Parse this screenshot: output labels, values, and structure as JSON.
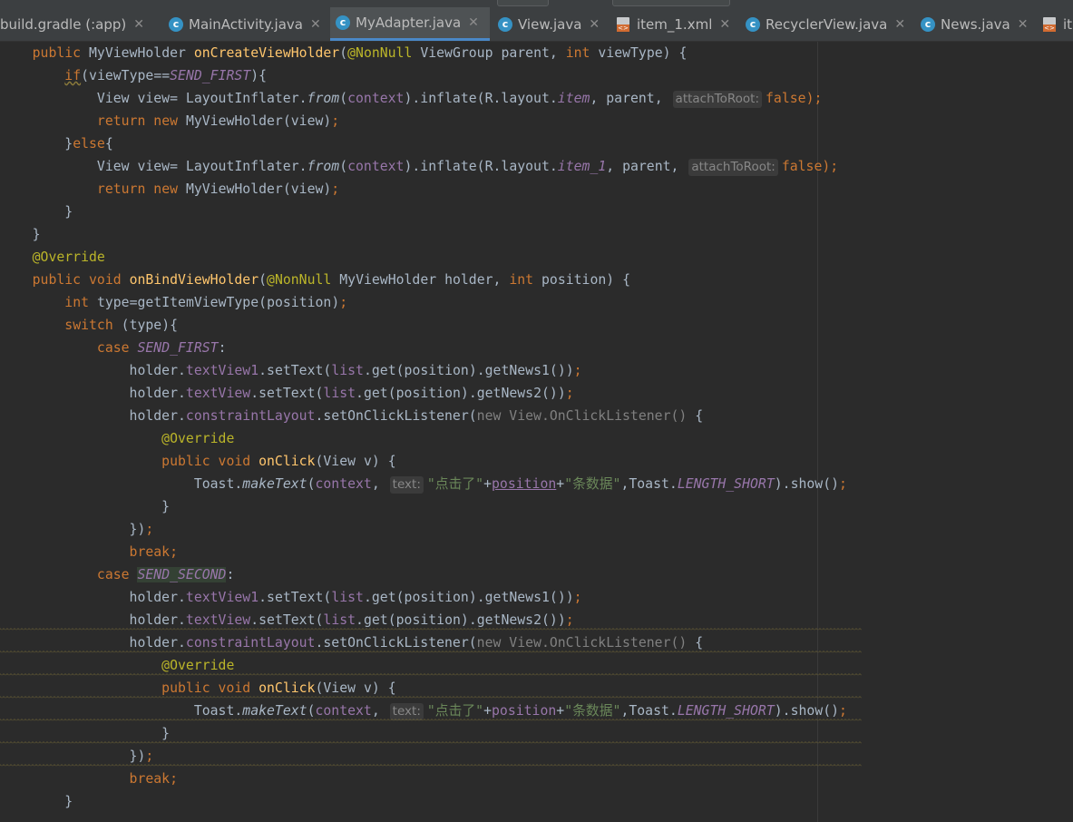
{
  "tabs": [
    {
      "label": "build.gradle (:app)",
      "icon": "gradle-icon",
      "active": false
    },
    {
      "label": "MainActivity.java",
      "icon": "java-class-icon",
      "active": false
    },
    {
      "label": "MyAdapter.java",
      "icon": "java-class-icon",
      "active": true
    },
    {
      "label": "View.java",
      "icon": "java-class-icon",
      "active": false
    },
    {
      "label": "item_1.xml",
      "icon": "xml-file-icon",
      "active": false
    },
    {
      "label": "RecyclerView.java",
      "icon": "java-class-icon",
      "active": false
    },
    {
      "label": "News.java",
      "icon": "java-class-icon",
      "active": false
    },
    {
      "label": "it",
      "icon": "xml-file-icon",
      "active": false
    }
  ],
  "tab_close_glyph": "✕",
  "code": {
    "kw_public": "public",
    "kw_void": "void",
    "kw_int": "int",
    "kw_if": "if",
    "kw_else": "else",
    "kw_return": "return",
    "kw_new": "new",
    "kw_switch": "switch",
    "kw_case": "case",
    "kw_break": "break",
    "lit_false": "false",
    "ann_override": "@Override",
    "ann_nonnull": "@NonNull",
    "m_onCreateViewHolder": "onCreateViewHolder",
    "m_onBindViewHolder": "onBindViewHolder",
    "m_onClick": "onClick",
    "t_MyViewHolder": "MyViewHolder",
    "t_ViewGroup": "ViewGroup",
    "t_View": "View",
    "t_LayoutInflater": "LayoutInflater",
    "t_Toast": "Toast",
    "p_parent": "parent",
    "p_viewType": "viewType",
    "p_holder": "holder",
    "p_position": "position",
    "p_type": "type",
    "p_v": "v",
    "c_SEND_FIRST": "SEND_FIRST",
    "c_SEND_SECOND": "SEND_SECOND",
    "c_LENGTH_SHORT": "LENGTH_SHORT",
    "f_context": "context",
    "f_textView1": "textView1",
    "f_textView": "textView",
    "f_constraintLayout": "constraintLayout",
    "f_list": "list",
    "m_from": "from",
    "m_inflate": "inflate",
    "m_getItemViewType": "getItemViewType",
    "m_setText": "setText",
    "m_get": "get",
    "m_getNews1": "getNews1",
    "m_getNews2": "getNews2",
    "m_setOnClickListener": "setOnClickListener",
    "m_makeText": "makeText",
    "m_show": "show",
    "r_R": "R",
    "r_layout": "layout",
    "r_item": "item",
    "r_item_1": "item_1",
    "anon_new_listener": "new View.OnClickListener()",
    "hint_attachToRoot": "attachToRoot:",
    "hint_text": "text:",
    "str_clicked": "\"点击了\"",
    "str_items": "\"条数据\""
  }
}
